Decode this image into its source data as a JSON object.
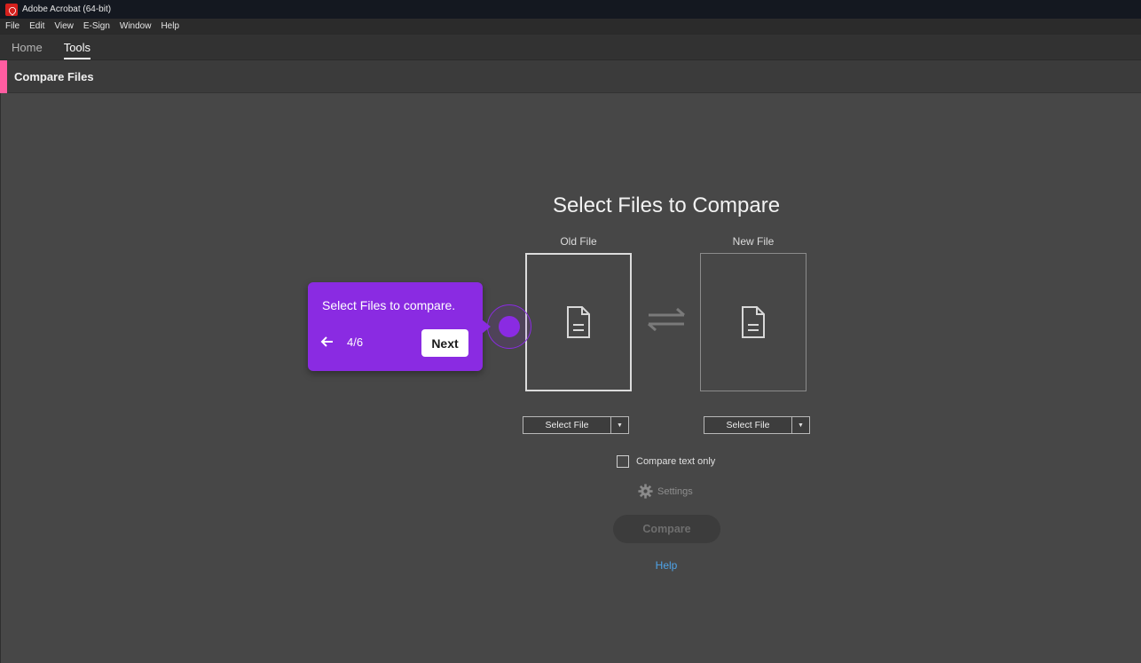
{
  "window": {
    "title": "Adobe Acrobat (64-bit)",
    "logo_icon": "acrobat-logo-icon"
  },
  "menu": [
    "File",
    "Edit",
    "View",
    "E-Sign",
    "Window",
    "Help"
  ],
  "tabs": [
    {
      "label": "Home",
      "active": false
    },
    {
      "label": "Tools",
      "active": true
    }
  ],
  "tool": {
    "title": "Compare Files",
    "accent_color": "#ff5da1"
  },
  "compare": {
    "heading": "Select Files to Compare",
    "old_file": {
      "label": "Old File",
      "button": "Select File",
      "icon": "document-icon"
    },
    "new_file": {
      "label": "New File",
      "button": "Select File",
      "icon": "document-icon"
    },
    "swap_icon": "swap-arrows-icon",
    "compare_text_only": {
      "label": "Compare text only",
      "checked": false
    },
    "settings_label": "Settings",
    "compare_button": "Compare",
    "help_link": "Help"
  },
  "coachmark": {
    "text": "Select Files to compare.",
    "step": "4/6",
    "next_label": "Next",
    "color": "#8a2be2"
  }
}
